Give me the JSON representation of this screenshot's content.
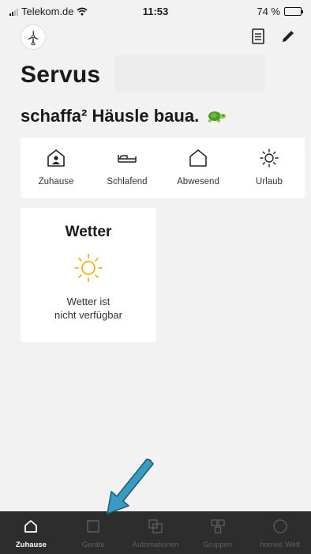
{
  "status_bar": {
    "carrier": "Telekom.de",
    "time": "11:53",
    "battery": "74 %",
    "battery_level": 0.74,
    "icons": [
      "signal-icon",
      "wifi-icon",
      "battery-icon"
    ]
  },
  "header": {
    "logo_icon": "windmill-logo",
    "list_icon": "document-list-icon",
    "edit_icon": "pencil-icon",
    "greeting": "Servus",
    "motto": "schaffa² Häusle baua.",
    "motto_icon": "turtle-icon"
  },
  "modes": [
    {
      "label": "Zuhause",
      "icon": "home-person-icon",
      "active": true
    },
    {
      "label": "Schlafend",
      "icon": "bed-icon",
      "active": false
    },
    {
      "label": "Abwesend",
      "icon": "house-outline-icon",
      "active": false
    },
    {
      "label": "Urlaub",
      "icon": "sun-icon",
      "active": false
    }
  ],
  "weather": {
    "title": "Wetter",
    "icon": "sun-icon",
    "message_line1": "Wetter ist",
    "message_line2": "nicht verfügbar"
  },
  "tabs": [
    {
      "label": "Zuhause",
      "icon": "house-icon",
      "active": true
    },
    {
      "label": "Geräte",
      "icon": "square-icon",
      "active": false
    },
    {
      "label": "Automationen",
      "icon": "overlap-squares-icon",
      "active": false
    },
    {
      "label": "Gruppen",
      "icon": "grid-icon",
      "active": false
    },
    {
      "label": "homee Welt",
      "icon": "circle-icon",
      "active": false
    }
  ],
  "colors": {
    "background": "#f2f2f2",
    "card": "#ffffff",
    "tab_bar": "#2d2d2d",
    "tab_inactive": "#5f5f5f",
    "sun": "#f2b01e",
    "arrow": "#3a9ac0",
    "turtle": "#4c9a2a"
  }
}
